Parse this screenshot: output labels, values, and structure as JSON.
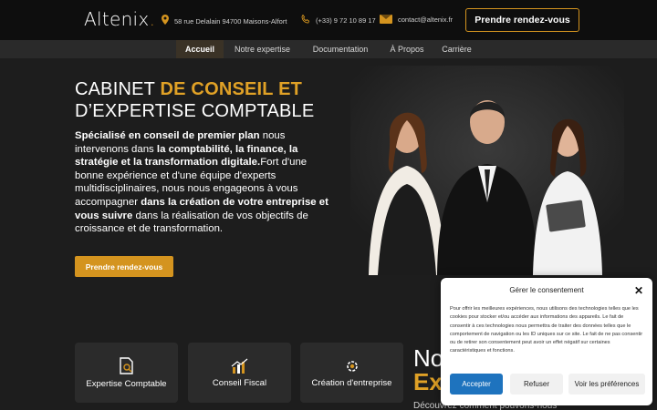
{
  "header": {
    "logo": "Altenix",
    "logo_dot": ".",
    "address": "58 rue Delalain 94700 Maisons-Alfort",
    "phone": "(+33) 9 72 10 89 17",
    "email": "contact@altenix.fr",
    "cta": "Prendre rendez-vous"
  },
  "nav": [
    "Accueil",
    "Notre expertise",
    "Documentation",
    "À Propos",
    "Carrière"
  ],
  "hero": {
    "title_1": "CABINET ",
    "title_gold": "DE CONSEIL ET",
    "title_2": "D’EXPERTISE COMPTABLE",
    "p1_b": "Spécialisé en conseil de premier plan",
    "p1": " nous intervenons dans ",
    "p2_b": "la comptabilité, la finance, la stratégie et la transformation digitale.",
    "p2": "Fort d'une bonne expérience et d'une équipe d'experts multidisciplinaires, nous nous engageons à vous accompagner ",
    "p3_b": "dans la création de votre entreprise et vous suivre",
    "p3": " dans la réalisation de vos objectifs de croissance et de transformation.",
    "cta": "Prendre rendez-vous"
  },
  "cards": [
    "Expertise Comptable",
    "Conseil Fiscal",
    "Création d'entreprise"
  ],
  "side": {
    "big": "No",
    "gold": "Ex",
    "sub": "Découvrez comment pouvons-nous"
  },
  "consent": {
    "title": "Gérer le consentement",
    "close": "✕",
    "body": "Pour offrir les meilleures expériences, nous utilisons des technologies telles que les cookies pour stocker et/ou accéder aux informations des appareils. Le fait de consentir à ces technologies nous permettra de traiter des données telles que le comportement de navigation ou les ID uniques sur ce site. Le fait de ne pas consentir ou de retirer son consentement peut avoir un effet négatif sur certaines caractéristiques et fonctions.",
    "accept": "Accepter",
    "refuse": "Refuser",
    "prefs": "Voir les préférences"
  },
  "colors": {
    "accent": "#d4941f",
    "gold_text": "#e0a126",
    "header_bg": "#0e0e0e",
    "consent_primary": "#1e73be"
  },
  "icons": {
    "address": "location-pin-icon",
    "phone": "phone-icon",
    "email": "mail-icon"
  }
}
